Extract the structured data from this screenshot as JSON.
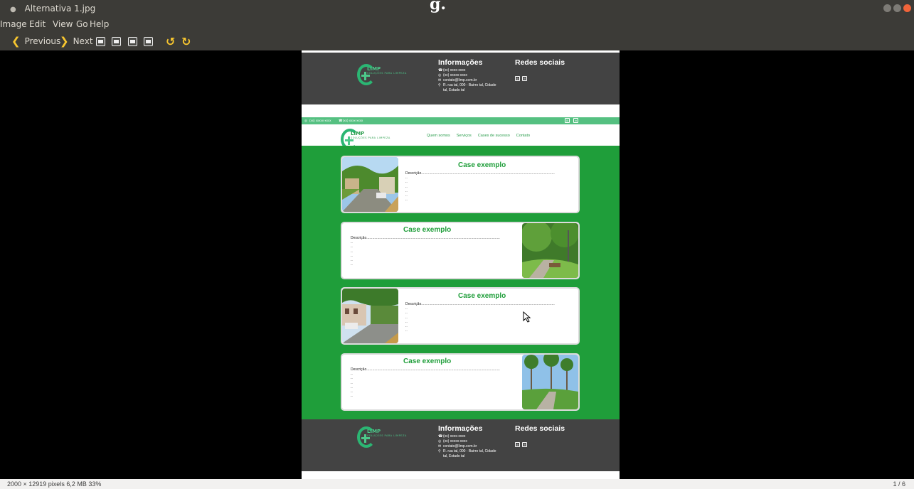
{
  "window": {
    "title": "Alternativa 1.jpg",
    "behind_text": "g."
  },
  "menu": [
    "Image",
    "Edit",
    "View",
    "Go",
    "Help"
  ],
  "toolbar": {
    "previous_label": "Previous",
    "next_label": "Next"
  },
  "status": {
    "left": "2000 × 12919 pixels  6,2 MB  33%",
    "right": "1 / 6"
  },
  "site": {
    "logo": {
      "name": "LIMP",
      "tagline": "SOLUÇÕES PARA LIMPEZA"
    },
    "footer": {
      "info_title": "Informações",
      "phone1": "(xx) xxxx-xxxx",
      "phone2": "(xx) xxxxx-xxxx",
      "email": "contato@limp.com.br",
      "address": "R. rua tal, 000 - Bairro tal, Cidade tal, Estado tal",
      "social_title": "Redes sociais"
    },
    "topbar": {
      "whatsapp": "(xx) xxxxx-xxxx",
      "phone": "(xx) xxxx-xxxx"
    },
    "nav": [
      "Quem somos",
      "Serviços",
      "Cases de sucesso",
      "Contato"
    ],
    "cases": [
      {
        "title": "Case exemplo",
        "description": "Descrição.......................................................................................................................................",
        "lines": [
          "..",
          "..",
          "..",
          "..",
          "..",
          ".."
        ]
      },
      {
        "title": "Case exemplo",
        "description": "Descrição.......................................................................................................................................",
        "lines": [
          "..",
          "..",
          "..",
          "..",
          "..",
          ".."
        ]
      },
      {
        "title": "Case exemplo",
        "description": "Descrição.......................................................................................................................................",
        "lines": [
          "..",
          "..",
          "..",
          "..",
          "..",
          ".."
        ]
      },
      {
        "title": "Case exemplo",
        "description": "Descrição.......................................................................................................................................",
        "lines": [
          "..",
          "..",
          "..",
          "..",
          "..",
          ".."
        ]
      }
    ]
  }
}
